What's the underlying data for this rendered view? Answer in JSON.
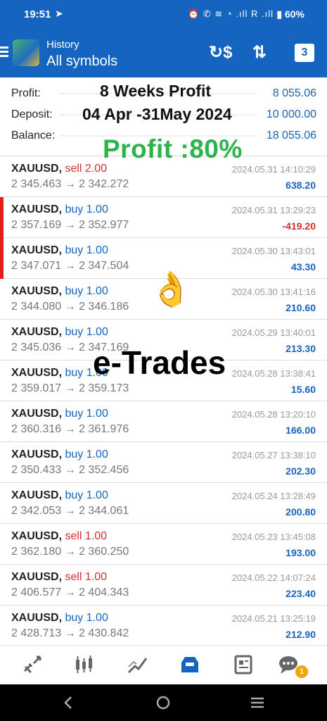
{
  "status_bar": {
    "time": "19:51",
    "icons": "⏰ ✆ ≋ ◔ .ıll R .ıll",
    "battery": "60%"
  },
  "header": {
    "subtitle": "History",
    "title": "All symbols",
    "icons": [
      "menu-icon",
      "logo",
      "currency-exchange-icon",
      "sort-icon",
      "calendar-icon"
    ],
    "calendar_day": "3"
  },
  "summary": {
    "profit_label": "Profit:",
    "profit_value": "8 055.06",
    "deposit_label": "Deposit:",
    "deposit_value": "10 000.00",
    "balance_label": "Balance:",
    "balance_value": "18 055.06"
  },
  "overlay": {
    "title": "8 Weeks Profit",
    "dates": "04 Apr -31May 2024",
    "profit": "Profit :80%",
    "emoji": "👌",
    "brand": "e-Trades"
  },
  "deals": [
    {
      "symbol": "XAUUSD,",
      "type": "sell 2.00",
      "side": "sell",
      "prices": "2 345.463 → 2 342.272",
      "time": "2024.05.31 14:10:29",
      "profit": "638.20",
      "neg": false,
      "marked": false
    },
    {
      "symbol": "XAUUSD,",
      "type": "buy 1.00",
      "side": "buy",
      "prices": "2 357.169 → 2 352.977",
      "time": "2024.05.31 13:29:23",
      "profit": "-419.20",
      "neg": true,
      "marked": true
    },
    {
      "symbol": "XAUUSD,",
      "type": "buy 1.00",
      "side": "buy",
      "prices": "2 347.071 → 2 347.504",
      "time": "2024.05.30 13:43:01",
      "profit": "43.30",
      "neg": false,
      "marked": true
    },
    {
      "symbol": "XAUUSD,",
      "type": "buy 1.00",
      "side": "buy",
      "prices": "2 344.080 → 2 346.186",
      "time": "2024.05.30 13:41:16",
      "profit": "210.60",
      "neg": false,
      "marked": false
    },
    {
      "symbol": "XAUUSD,",
      "type": "buy 1.00",
      "side": "buy",
      "prices": "2 345.036 → 2 347.169",
      "time": "2024.05.29 13:40:01",
      "profit": "213.30",
      "neg": false,
      "marked": false
    },
    {
      "symbol": "XAUUSD,",
      "type": "buy 1.00",
      "side": "buy",
      "prices": "2 359.017 → 2 359.173",
      "time": "2024.05.28 13:38:41",
      "profit": "15.60",
      "neg": false,
      "marked": false
    },
    {
      "symbol": "XAUUSD,",
      "type": "buy 1.00",
      "side": "buy",
      "prices": "2 360.316 → 2 361.976",
      "time": "2024.05.28 13:20:10",
      "profit": "166.00",
      "neg": false,
      "marked": false
    },
    {
      "symbol": "XAUUSD,",
      "type": "buy 1.00",
      "side": "buy",
      "prices": "2 350.433 → 2 352.456",
      "time": "2024.05.27 13:38:10",
      "profit": "202.30",
      "neg": false,
      "marked": false
    },
    {
      "symbol": "XAUUSD,",
      "type": "buy 1.00",
      "side": "buy",
      "prices": "2 342.053 → 2 344.061",
      "time": "2024.05.24 13:28:49",
      "profit": "200.80",
      "neg": false,
      "marked": false
    },
    {
      "symbol": "XAUUSD,",
      "type": "sell 1.00",
      "side": "sell",
      "prices": "2 362.180 → 2 360.250",
      "time": "2024.05.23 13:45:08",
      "profit": "193.00",
      "neg": false,
      "marked": false
    },
    {
      "symbol": "XAUUSD,",
      "type": "sell 1.00",
      "side": "sell",
      "prices": "2 406.577 → 2 404.343",
      "time": "2024.05.22 14:07:24",
      "profit": "223.40",
      "neg": false,
      "marked": false
    },
    {
      "symbol": "XAUUSD,",
      "type": "buy 1.00",
      "side": "buy",
      "prices": "2 428.713 → 2 430.842",
      "time": "2024.05.21 13:25:19",
      "profit": "212.90",
      "neg": false,
      "marked": false
    }
  ],
  "bottom_nav": {
    "items": [
      "quotes-icon",
      "chart-icon",
      "trade-icon",
      "history-icon",
      "news-icon",
      "messages-icon"
    ],
    "active": "history-icon",
    "badge": "1"
  },
  "system_nav": [
    "back-icon",
    "home-icon",
    "recents-icon"
  ],
  "colors": {
    "primary": "#1565c0",
    "sell": "#d32f2f",
    "overlay_green": "#2eb24a",
    "badge": "#f4a300"
  }
}
